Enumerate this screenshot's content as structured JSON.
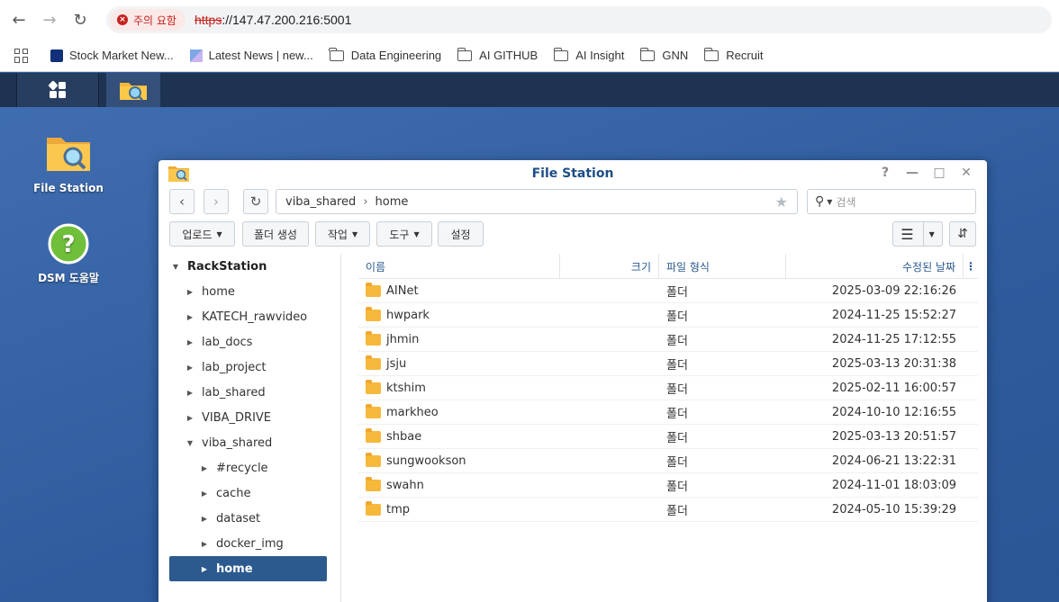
{
  "browser": {
    "security_label": "주의 요함",
    "url_protocol": "https",
    "url_rest": "://147.47.200.216:5001",
    "bookmarks": [
      {
        "label": "Stock Market New...",
        "icon": "stock-favicon-icon"
      },
      {
        "label": "Latest News | new...",
        "icon": "news-favicon-icon"
      },
      {
        "label": "Data Engineering",
        "icon": "folder-icon"
      },
      {
        "label": "AI GITHUB",
        "icon": "folder-icon"
      },
      {
        "label": "AI Insight",
        "icon": "folder-icon"
      },
      {
        "label": "GNN",
        "icon": "folder-icon"
      },
      {
        "label": "Recruit",
        "icon": "folder-icon"
      }
    ]
  },
  "desktop": {
    "icons": [
      {
        "label": "File Station",
        "icon": "file-station-icon"
      },
      {
        "label": "DSM 도움말",
        "icon": "help-icon"
      }
    ]
  },
  "window": {
    "title": "File Station",
    "path": [
      "viba_shared",
      "home"
    ],
    "search_placeholder": "검색",
    "toolbar": {
      "upload": "업로드",
      "create_folder": "폴더 생성",
      "action": "작업",
      "tools": "도구",
      "settings": "설정"
    },
    "tree": {
      "root": "RackStation",
      "items": [
        "home",
        "KATECH_rawvideo",
        "lab_docs",
        "lab_project",
        "lab_shared",
        "VIBA_DRIVE",
        "viba_shared"
      ],
      "children": [
        "#recycle",
        "cache",
        "dataset",
        "docker_img",
        "home"
      ],
      "selected": "home"
    },
    "columns": {
      "name": "이름",
      "size": "크기",
      "type": "파일 형식",
      "modified": "수정된 날짜"
    },
    "files": [
      {
        "name": "AINet",
        "size": "",
        "type": "폴더",
        "modified": "2025-03-09 22:16:26"
      },
      {
        "name": "hwpark",
        "size": "",
        "type": "폴더",
        "modified": "2024-11-25 15:52:27"
      },
      {
        "name": "jhmin",
        "size": "",
        "type": "폴더",
        "modified": "2024-11-25 17:12:55"
      },
      {
        "name": "jsju",
        "size": "",
        "type": "폴더",
        "modified": "2025-03-13 20:31:38"
      },
      {
        "name": "ktshim",
        "size": "",
        "type": "폴더",
        "modified": "2025-02-11 16:00:57"
      },
      {
        "name": "markheo",
        "size": "",
        "type": "폴더",
        "modified": "2024-10-10 12:16:55"
      },
      {
        "name": "shbae",
        "size": "",
        "type": "폴더",
        "modified": "2025-03-13 20:51:57"
      },
      {
        "name": "sungwookson",
        "size": "",
        "type": "폴더",
        "modified": "2024-06-21 13:22:31"
      },
      {
        "name": "swahn",
        "size": "",
        "type": "폴더",
        "modified": "2024-11-01 18:03:09"
      },
      {
        "name": "tmp",
        "size": "",
        "type": "폴더",
        "modified": "2024-05-10 15:39:29"
      }
    ]
  }
}
